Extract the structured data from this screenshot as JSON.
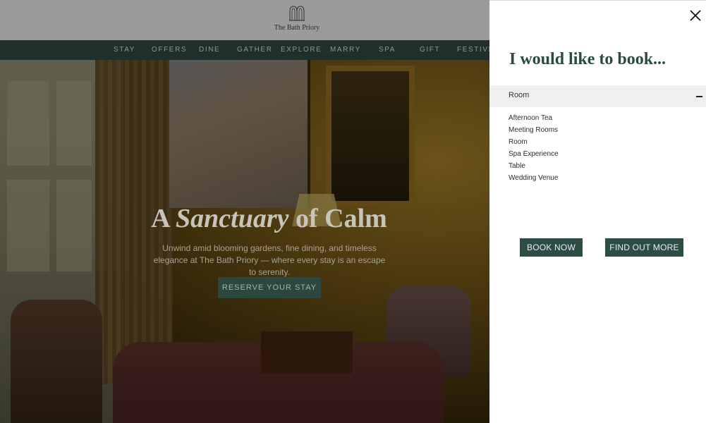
{
  "site": {
    "brand": "The Bath Priory",
    "nav": [
      "STAY",
      "OFFERS",
      "DINE",
      "GATHER",
      "EXPLORE",
      "MARRY",
      "SPA",
      "GIFT",
      "FESTIVE"
    ]
  },
  "hero": {
    "title_a": "A ",
    "title_em": "Sanctuary",
    "title_b": " of Calm",
    "subtitle": "Unwind amid blooming gardens, fine dining, and timeless elegance at The Bath Priory — where every stay is an escape to serenity.",
    "cta": "RESERVE YOUR STAY"
  },
  "drawer": {
    "title": "I would like to book...",
    "selected": "Room",
    "options": [
      "Afternoon Tea",
      "Meeting Rooms",
      "Room",
      "Spa Experience",
      "Table",
      "Wedding Venue"
    ],
    "book_now": "BOOK NOW",
    "find_out_more": "FIND OUT MORE"
  },
  "colors": {
    "brand_green": "#2d4c46",
    "nav_bg": "#1f2f2c",
    "title_green": "#2c4a44"
  },
  "icons": {
    "close": "close-icon",
    "collapse": "minus-icon",
    "logo": "arch-logo-icon"
  }
}
